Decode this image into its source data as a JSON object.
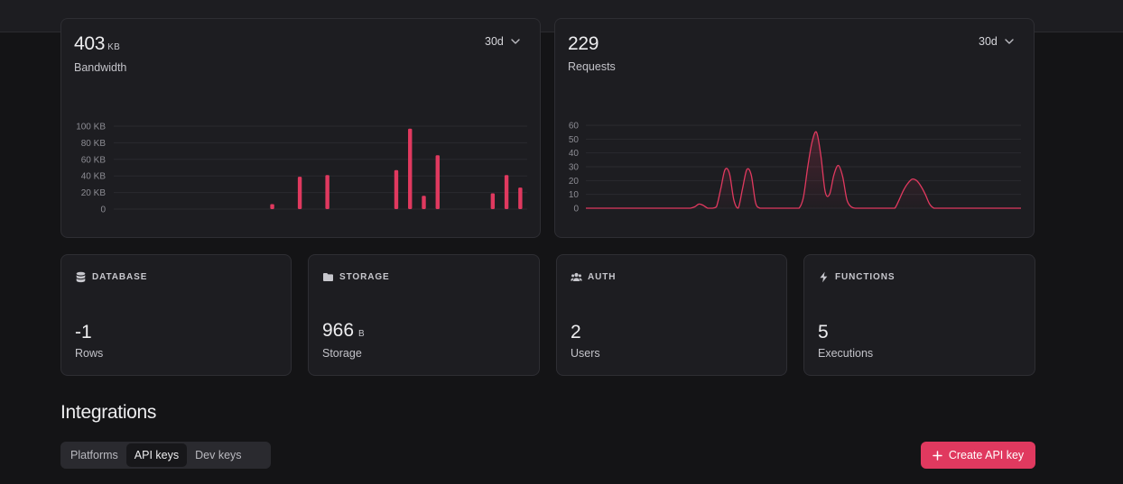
{
  "bandwidth": {
    "value": "403",
    "unit": "KB",
    "label": "Bandwidth",
    "range": "30d"
  },
  "requests": {
    "value": "229",
    "label": "Requests",
    "range": "30d"
  },
  "chart_data": [
    {
      "type": "bar",
      "y_ticks": [
        "0",
        "20 KB",
        "40 KB",
        "60 KB",
        "80 KB",
        "100 KB"
      ],
      "ylim": [
        0,
        100
      ],
      "y_unit": "KB",
      "bar_color": "#e0395f",
      "grid": true,
      "x": [
        0,
        1,
        2,
        3,
        4,
        5,
        6,
        7,
        8,
        9,
        10,
        11,
        12,
        13,
        14,
        15,
        16,
        17,
        18,
        19,
        20,
        21,
        22,
        23,
        24,
        25,
        26,
        27,
        28,
        29
      ],
      "values": [
        0,
        0,
        0,
        0,
        0,
        0,
        0,
        0,
        0,
        0,
        0,
        6,
        0,
        39,
        0,
        41,
        0,
        0,
        0,
        0,
        47,
        97,
        16,
        65,
        0,
        0,
        0,
        19,
        41,
        26
      ]
    },
    {
      "type": "area",
      "y_ticks": [
        "0",
        "10",
        "20",
        "30",
        "40",
        "50",
        "60"
      ],
      "ylim": [
        0,
        60
      ],
      "line_color": "#e0395f",
      "grid": true,
      "x": [
        0,
        1,
        2,
        3,
        4,
        5,
        6,
        7,
        8,
        9,
        10,
        11,
        12,
        13,
        14,
        15,
        16,
        17,
        18,
        19,
        20,
        21,
        22,
        23,
        24,
        25,
        26,
        27,
        28,
        29,
        30,
        31,
        32,
        33,
        34,
        35,
        36,
        37,
        38,
        39,
        40,
        41,
        42,
        43,
        44,
        45,
        46,
        47,
        48,
        49,
        50,
        51,
        52,
        53,
        54,
        55,
        56,
        57,
        58,
        59,
        60,
        61,
        62,
        63,
        64,
        65,
        66,
        67,
        68,
        69,
        70,
        71,
        72,
        73,
        74,
        75,
        76,
        77,
        78,
        79,
        80,
        81,
        82,
        83,
        84,
        85,
        86,
        87,
        88,
        89,
        90,
        91,
        92,
        93,
        94,
        95,
        96,
        97,
        98,
        99,
        100
      ],
      "values": [
        0,
        0,
        0,
        0,
        0,
        0,
        0,
        0,
        0,
        0,
        0,
        0,
        0,
        0,
        0,
        0,
        0,
        0,
        0,
        0,
        0,
        0,
        0,
        0,
        0,
        1,
        3,
        2,
        0,
        0,
        1,
        14,
        28,
        25,
        6,
        0,
        14,
        28,
        24,
        4,
        0,
        0,
        0,
        0,
        0,
        0,
        0,
        0,
        0,
        0,
        8,
        30,
        48,
        55,
        38,
        12,
        10,
        24,
        31,
        23,
        6,
        1,
        0,
        0,
        0,
        0,
        0,
        0,
        0,
        0,
        0,
        0,
        6,
        13,
        18,
        21,
        20,
        16,
        10,
        3,
        0,
        0,
        0,
        0,
        0,
        0,
        0,
        0,
        0,
        0,
        0,
        0,
        0,
        0,
        0,
        0,
        0,
        0,
        0,
        0,
        0
      ]
    }
  ],
  "stats": [
    {
      "title": "DATABASE",
      "icon": "database-icon",
      "value": "-1",
      "unit": "",
      "label": "Rows"
    },
    {
      "title": "STORAGE",
      "icon": "folder-icon",
      "value": "966",
      "unit": "B",
      "label": "Storage"
    },
    {
      "title": "AUTH",
      "icon": "users-icon",
      "value": "2",
      "unit": "",
      "label": "Users"
    },
    {
      "title": "FUNCTIONS",
      "icon": "lightning-icon",
      "value": "5",
      "unit": "",
      "label": "Executions"
    }
  ],
  "integrations": {
    "title": "Integrations",
    "tabs": [
      "Platforms",
      "API keys",
      "Dev keys"
    ],
    "active_tab": "API keys",
    "create_button": "Create API key"
  },
  "colors": {
    "accent": "#e0395f",
    "background": "#141416",
    "card": "#1d1d21"
  }
}
